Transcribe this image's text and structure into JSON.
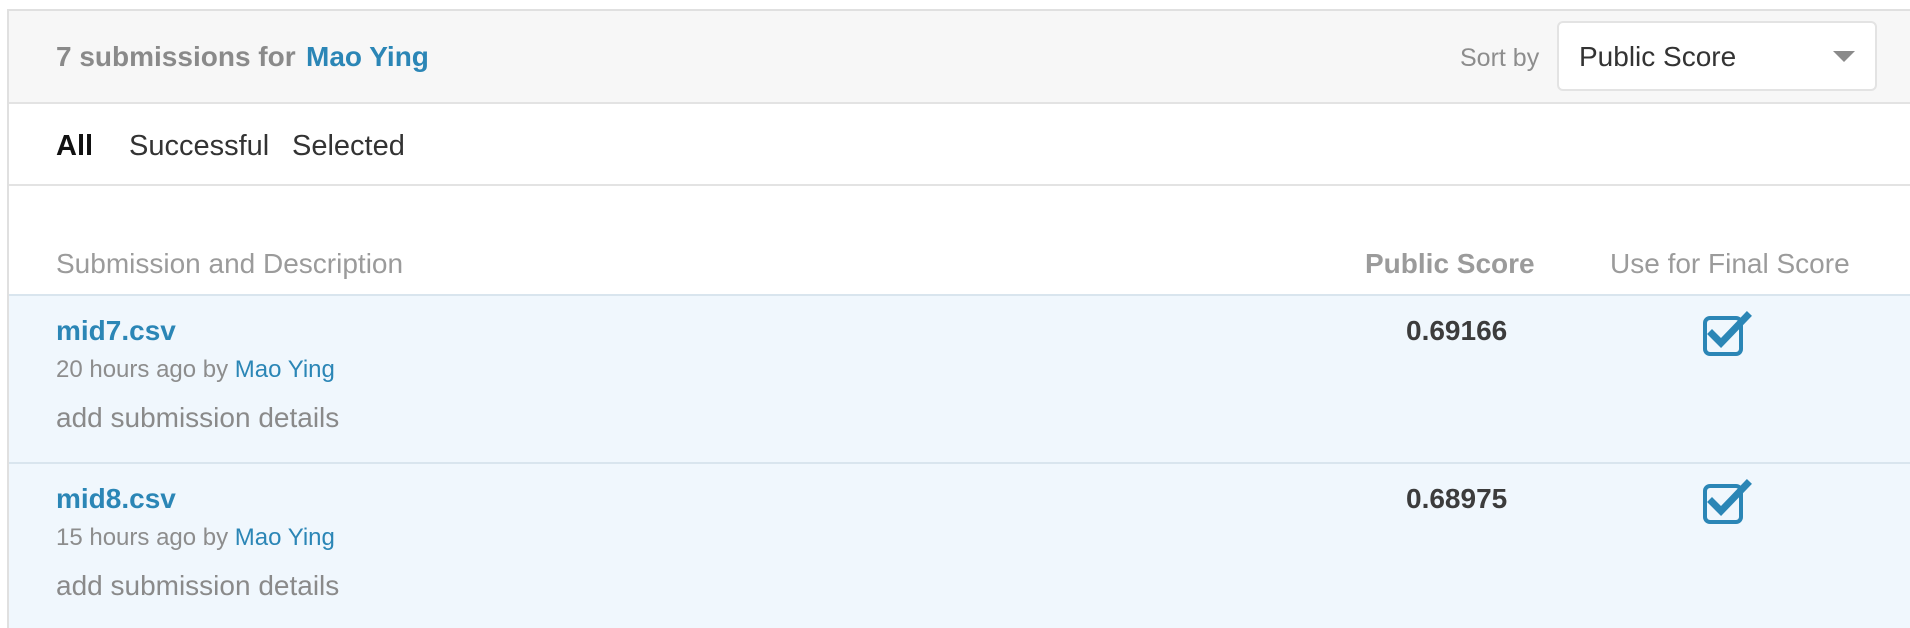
{
  "header": {
    "count_text": "7 submissions for",
    "owner": "Mao Ying",
    "sort_label": "Sort by",
    "sort_value": "Public Score"
  },
  "tabs": [
    {
      "label": "All",
      "active": true
    },
    {
      "label": "Successful",
      "active": false
    },
    {
      "label": "Selected",
      "active": false
    }
  ],
  "columns": {
    "submission": "Submission and Description",
    "public_score": "Public Score",
    "final": "Use for Final Score"
  },
  "rows": [
    {
      "file": "mid7.csv",
      "time": "20 hours ago by",
      "author": "Mao Ying",
      "details": "add submission details",
      "score": "0.69166",
      "selected": true
    },
    {
      "file": "mid8.csv",
      "time": "15 hours ago by",
      "author": "Mao Ying",
      "details": "add submission details",
      "score": "0.68975",
      "selected": true
    }
  ],
  "colors": {
    "accent": "#2b86b6",
    "row_bg": "#f0f7fd",
    "header_bg": "#f7f7f7",
    "muted_text": "#8a8a8a"
  },
  "icons": {
    "checkbox": "checked-checkbox-icon",
    "dropdown": "caret-down-icon"
  }
}
